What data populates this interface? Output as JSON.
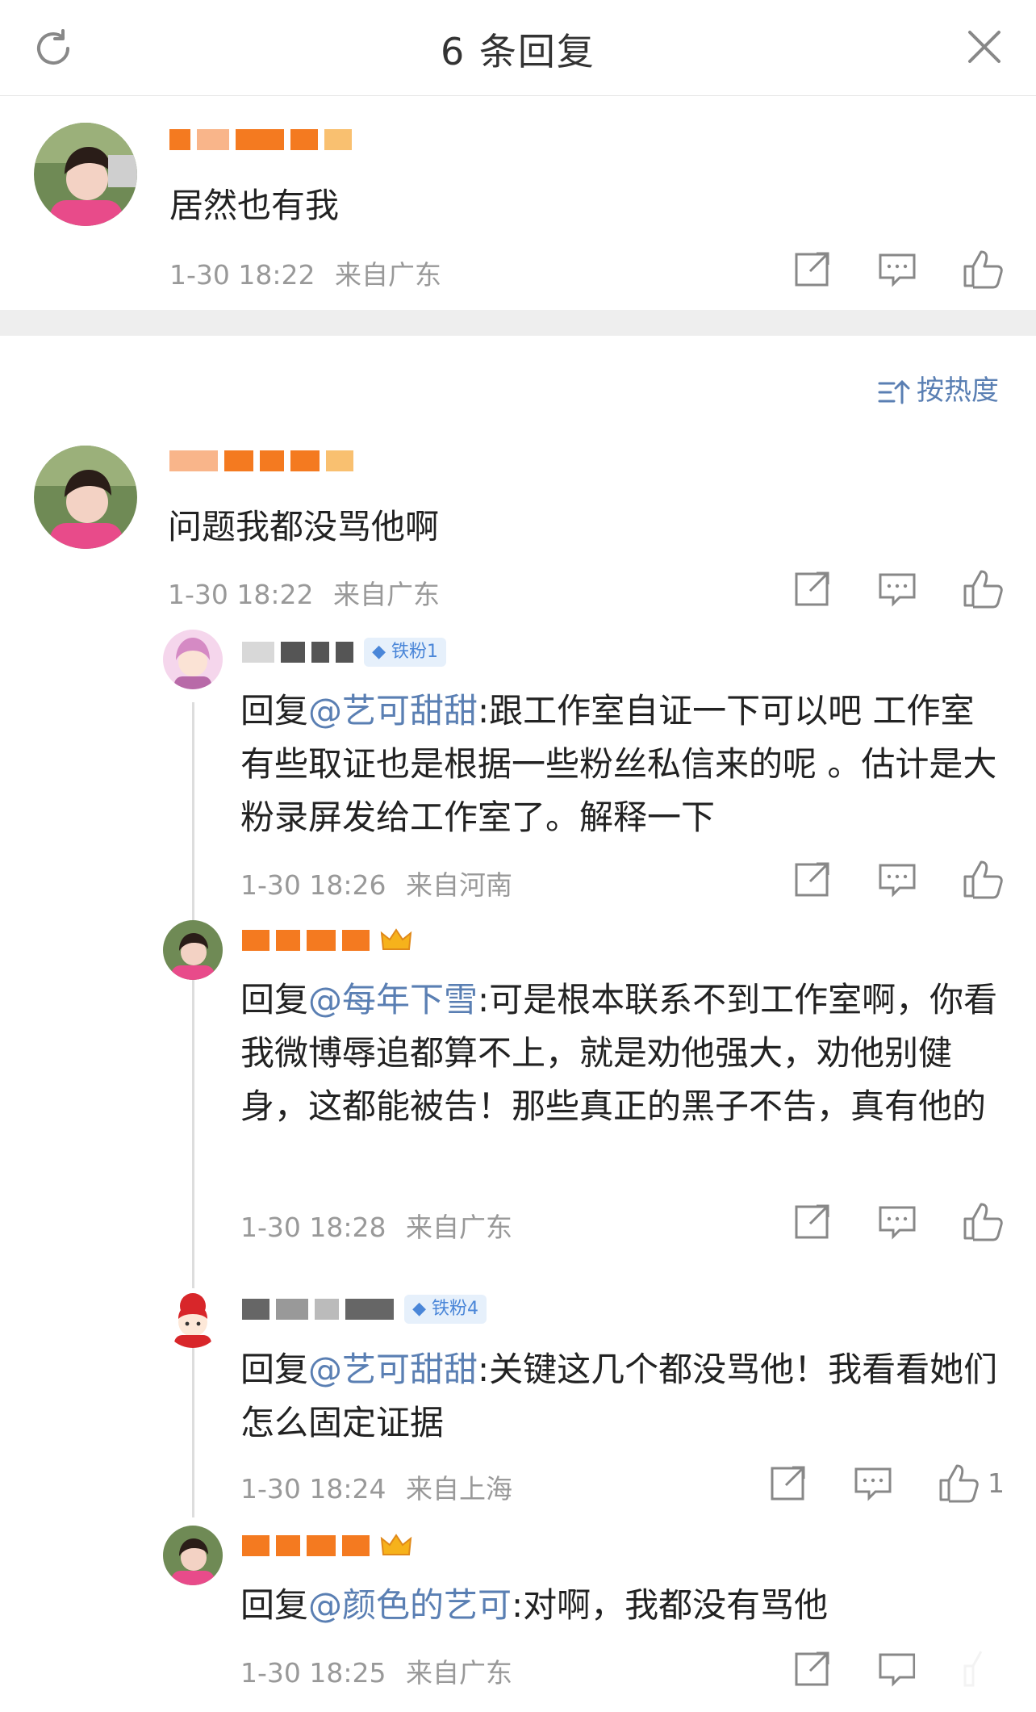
{
  "header": {
    "title": "6 条回复"
  },
  "sort": {
    "label": "按热度"
  },
  "main_comment": {
    "name": "",
    "text": "居然也有我",
    "time": "1-30 18:22",
    "location": "来自广东"
  },
  "replies": [
    {
      "name": "",
      "text": "问题我都没骂他啊",
      "time": "1-30 18:22",
      "location": "来自广东"
    },
    {
      "badge": "铁粉1",
      "reply_prefix": "回复",
      "mention": "@艺可甜甜",
      "text": ":跟工作室自证一下可以吧  工作室有些取证也是根据一些粉丝私信来的呢 。估计是大粉录屏发给工作室了。解释一下",
      "time": "1-30 18:26",
      "location": "来自河南"
    },
    {
      "reply_prefix": "回复",
      "mention": "@每年下雪",
      "text": ":可是根本联系不到工作室啊，你看我微博辱追都算不上，就是劝他强大，劝他别健身，这都能被告！那些真正的黑子不告，真有他的",
      "time": "1-30 18:28",
      "location": "来自广东"
    },
    {
      "badge": "铁粉4",
      "reply_prefix": "回复",
      "mention": "@艺可甜甜",
      "text": ":关键这几个都没骂他！我看看她们怎么固定证据",
      "time": "1-30 18:24",
      "location": "来自上海",
      "likes": "1"
    },
    {
      "reply_prefix": "回复",
      "mention": "@颜色的艺可",
      "text": ":对啊，我都没有骂他",
      "time": "1-30 18:25",
      "location": "来自广东"
    }
  ],
  "colors": {
    "mention": "#5a7fb3",
    "meta": "#999999",
    "badge_bg": "#e6f0fb",
    "orange": "#f47a20"
  }
}
